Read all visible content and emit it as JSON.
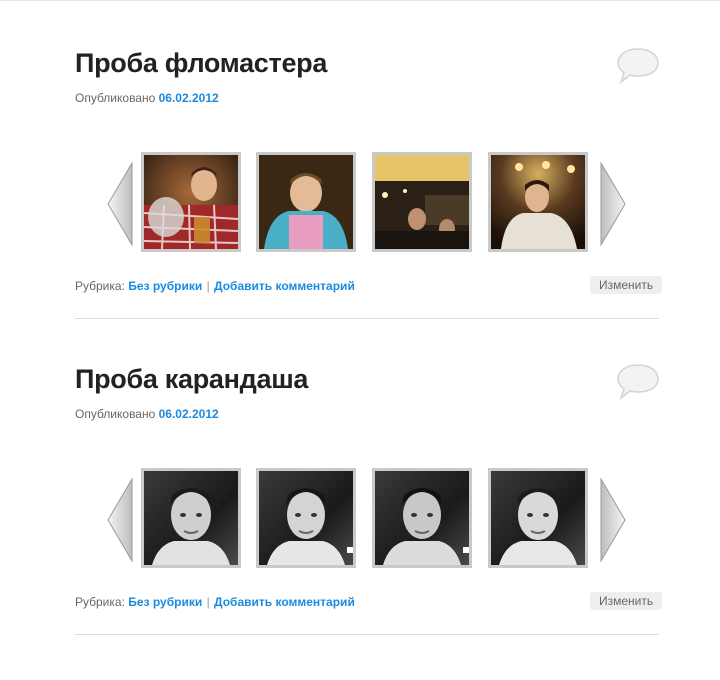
{
  "posts": [
    {
      "title": "Проба фломастера",
      "meta_prefix": "Опубликовано",
      "date": "06.02.2012",
      "thumbnails": [
        "photo-color-1",
        "photo-color-2",
        "photo-color-3",
        "photo-color-4"
      ],
      "category_prefix": "Рубрика:",
      "category": "Без рубрики",
      "separator": "|",
      "add_comment": "Добавить комментарий",
      "edit": "Изменить"
    },
    {
      "title": "Проба карандаша",
      "meta_prefix": "Опубликовано",
      "date": "06.02.2012",
      "thumbnails": [
        "photo-bw-1",
        "photo-bw-2",
        "photo-bw-3",
        "photo-bw-4"
      ],
      "category_prefix": "Рубрика:",
      "category": "Без рубрики",
      "separator": "|",
      "add_comment": "Добавить комментарий",
      "edit": "Изменить"
    }
  ],
  "icons": {
    "comment": "speech-bubble-icon",
    "prev": "left-arrow-icon",
    "next": "right-arrow-icon"
  },
  "colors": {
    "link": "#1b8be0",
    "title": "#222222",
    "thumb_border": "#c9c9c9"
  }
}
